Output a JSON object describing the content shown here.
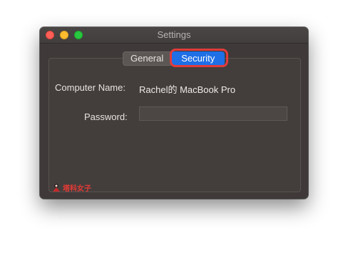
{
  "window": {
    "title": "Settings"
  },
  "tabs": [
    {
      "label": "General",
      "active": false
    },
    {
      "label": "Security",
      "active": true
    }
  ],
  "form": {
    "computer_name_label": "Computer Name:",
    "computer_name_value": "Rachel的 MacBook Pro",
    "password_label": "Password:",
    "password_value": ""
  },
  "watermark": {
    "text": "塔科女子"
  },
  "colors": {
    "window_bg": "#3f3a39",
    "accent": "#1f6fe6",
    "highlight": "#e23b3b",
    "close": "#ff5f57",
    "minimize": "#febc2e",
    "zoom": "#28c840",
    "watermark": "#e53935"
  }
}
